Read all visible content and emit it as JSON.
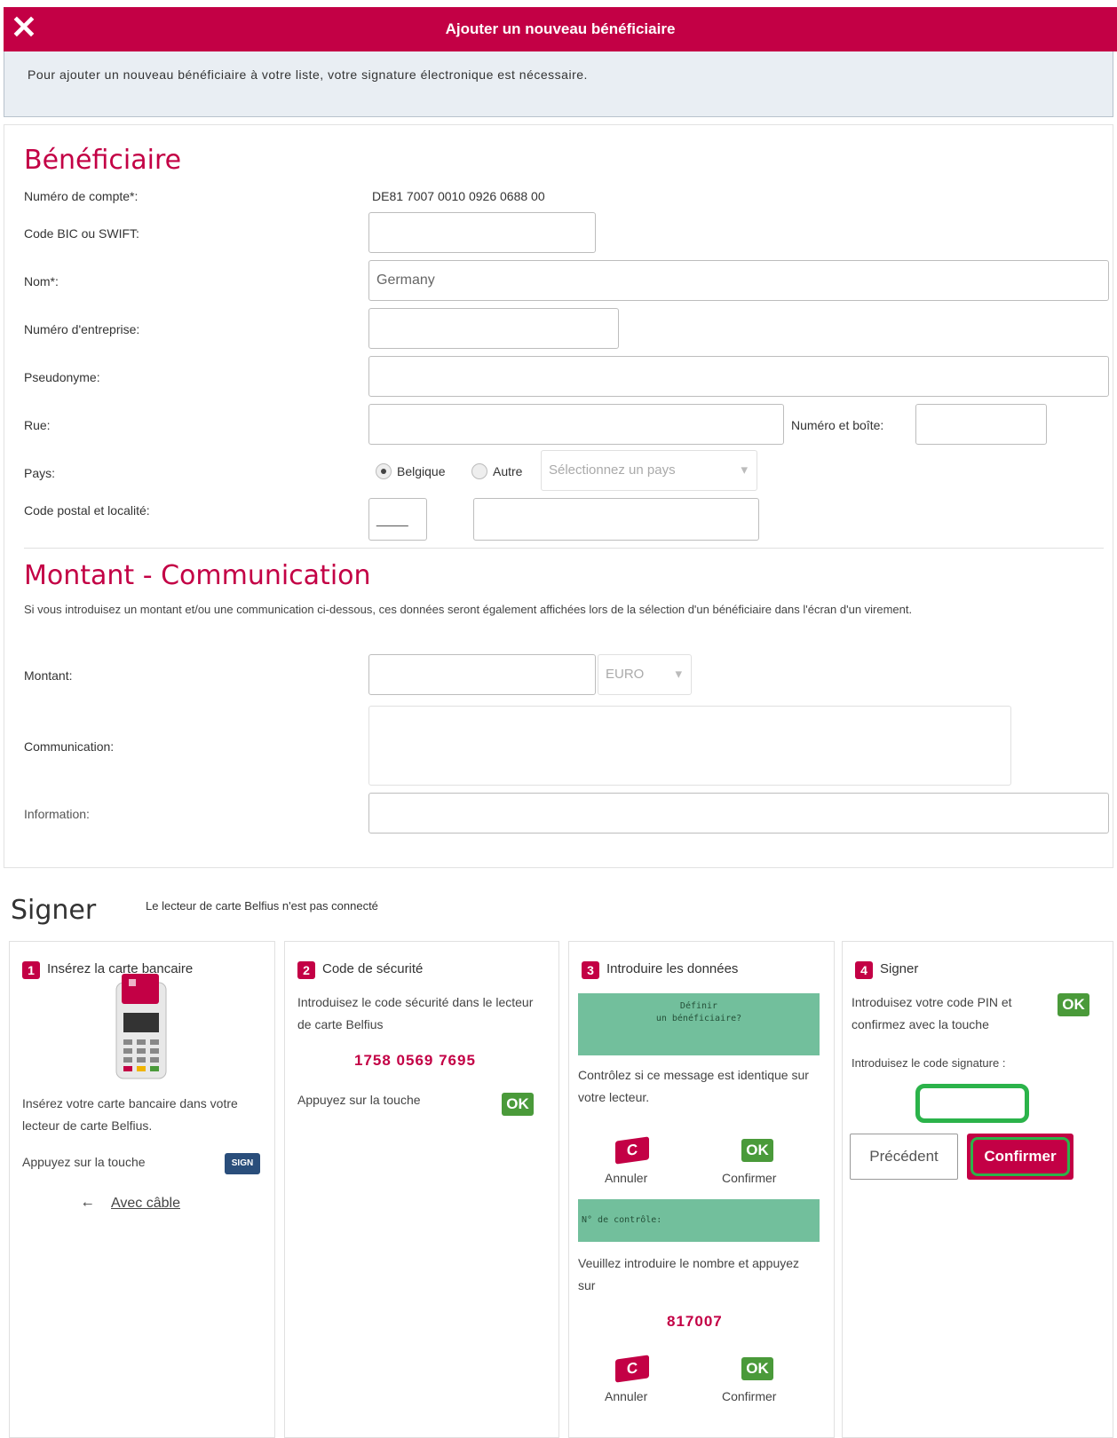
{
  "header": {
    "title": "Ajouter un nouveau bénéficiaire",
    "close_glyph": "✕"
  },
  "info": "Pour ajouter un nouveau bénéficiaire à votre liste, votre signature électronique est nécessaire.",
  "beneficiary": {
    "section_title": "Bénéficiaire",
    "account_label": "Numéro de compte*:",
    "account_value": "DE81 7007 0010 0926 0688 00",
    "bic_label": "Code BIC ou SWIFT:",
    "bic_value": "",
    "name_label": "Nom*:",
    "name_value": "Germany",
    "company_label": "Numéro d'entreprise:",
    "pseudo_label": "Pseudonyme:",
    "street_label": "Rue:",
    "number_label": "Numéro et boîte:",
    "country_label": "Pays:",
    "radio_belgique": "Belgique",
    "radio_autre": "Autre",
    "country_select": "Sélectionnez un pays",
    "postal_label": "Code postal et localité:",
    "postal_placeholder": "____"
  },
  "amount": {
    "section_title": "Montant - Communication",
    "description": "Si vous introduisez un montant et/ou une communication ci-dessous, ces données seront également affichées lors de la sélection d'un bénéficiaire dans l'écran d'un virement.",
    "amount_label": "Montant:",
    "currency": "EURO",
    "communication_label": "Communication:",
    "information_label": "Information:"
  },
  "signer": {
    "title": "Signer",
    "note": "Le lecteur de carte Belfius n'est pas connecté",
    "step1": {
      "num": "1",
      "head": "Insérez la carte bancaire",
      "text": "Insérez votre carte bancaire dans votre lecteur de carte Belfius.",
      "press": "Appuyez sur la touche",
      "sign_key": "SIGN",
      "cable_link": "Avec câble"
    },
    "step2": {
      "num": "2",
      "head": "Code de sécurité",
      "text": "Introduisez le code sécurité dans le lecteur de carte Belfius",
      "code": "1758 0569 7695",
      "press": "Appuyez sur la touche",
      "ok": "OK"
    },
    "step3": {
      "num": "3",
      "head": "Introduire les données",
      "lcd1_line1": "Définir",
      "lcd1_line2": "un bénéficiaire?",
      "check_text": "Contrôlez si ce message est identique sur votre lecteur.",
      "c_key": "C",
      "ok_key": "OK",
      "cancel": "Annuler",
      "confirm": "Confirmer",
      "lcd2": "N° de contrôle:",
      "enter_text": "Veuillez introduire le nombre et appuyez sur",
      "control_number": "817007"
    },
    "step4": {
      "num": "4",
      "head": "Signer",
      "pin_text": "Introduisez votre code PIN et confirmez avec la touche",
      "ok_key": "OK",
      "signature_label": "Introduisez le code signature :",
      "prev_button": "Précédent",
      "confirm_button": "Confirmer"
    }
  }
}
